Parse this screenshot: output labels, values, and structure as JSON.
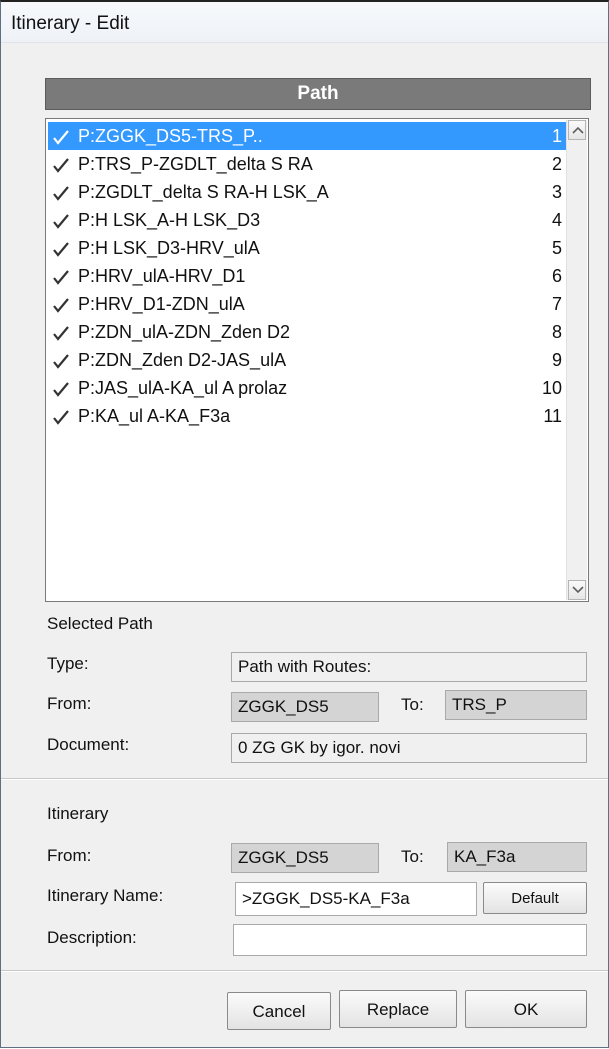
{
  "window": {
    "title": "Itinerary - Edit"
  },
  "list": {
    "header": "Path",
    "rows": [
      {
        "label": "P:ZGGK_DS5-TRS_P..",
        "num": "1",
        "selected": true
      },
      {
        "label": "P:TRS_P-ZGDLT_delta S RA",
        "num": "2"
      },
      {
        "label": "P:ZGDLT_delta S RA-H LSK_A",
        "num": "3"
      },
      {
        "label": "P:H LSK_A-H LSK_D3",
        "num": "4"
      },
      {
        "label": "P:H LSK_D3-HRV_ulA",
        "num": "5"
      },
      {
        "label": "P:HRV_ulA-HRV_D1",
        "num": "6"
      },
      {
        "label": "P:HRV_D1-ZDN_ulA",
        "num": "7"
      },
      {
        "label": "P:ZDN_ulA-ZDN_Zden D2",
        "num": "8"
      },
      {
        "label": "P:ZDN_Zden D2-JAS_ulA",
        "num": "9"
      },
      {
        "label": "P:JAS_ulA-KA_ul A prolaz",
        "num": "10"
      },
      {
        "label": "P:KA_ul A-KA_F3a",
        "num": "11"
      }
    ]
  },
  "selected_path": {
    "section_label": "Selected Path",
    "type_label": "Type:",
    "type_value": "Path with Routes:",
    "from_label": "From:",
    "from_value": "ZGGK_DS5",
    "to_label": "To:",
    "to_value": "TRS_P",
    "document_label": "Document:",
    "document_value": "0 ZG GK by igor. novi"
  },
  "itinerary": {
    "section_label": "Itinerary",
    "from_label": "From:",
    "from_value": "ZGGK_DS5",
    "to_label": "To:",
    "to_value": "KA_F3a",
    "name_label": "Itinerary Name:",
    "name_value": ">ZGGK_DS5-KA_F3a",
    "default_button": "Default",
    "description_label": "Description:",
    "description_value": ""
  },
  "buttons": {
    "cancel": "Cancel",
    "replace": "Replace",
    "ok": "OK"
  },
  "colors": {
    "selection": "#3399ff",
    "header": "#7a7a7a",
    "readonly_field": "#d4d4d4"
  },
  "icons": [
    "check-icon",
    "scroll-up-icon",
    "scroll-down-icon"
  ]
}
